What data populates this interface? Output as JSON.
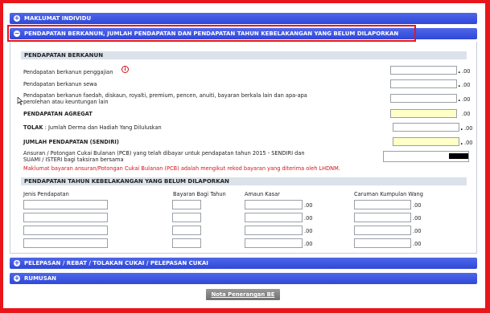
{
  "sections": {
    "maklumat_individu": "MAKLUMAT INDIVIDU",
    "pendapatan": "PENDAPATAN BERKANUN, JUMLAH PENDAPATAN DAN PENDAPATAN TAHUN KEBELAKANGAN YANG BELUM DILAPORKAN",
    "pelepasan": "PELEPASAN / REBAT / TOLAKAN CUKAI / PELEPASAN CUKAI",
    "rumusan": "RUMUSAN"
  },
  "berkanun": {
    "heading": "PENDAPATAN BERKANUN",
    "gaji": "Pendapatan berkanun penggajian",
    "sewa": "Pendapatan berkanun sewa",
    "faedah_1": "Pendapatan berkanun faedah, diskaun, royalti, premium, pencen, anuiti, bayaran berkala lain dan apa-apa",
    "faedah_2": "perolehan atau keuntungan lain",
    "agregat": "PENDAPATAN AGREGAT",
    "tolak_bold": "TOLAK",
    "tolak_rest": ": Jumlah Derma dan Hadiah Yang Diluluskan",
    "sendiri": "JUMLAH PENDAPATAN (SENDIRI)",
    "pcb_1": "Ansuran / Potongan Cukai Bulanan (PCB) yang telah dibayar untuk pendapatan tahun 2015 - SENDIRI dan",
    "pcb_2": "SUAMI / ISTERI bagi taksiran bersama",
    "note": "Maklumat bayaran ansuran/Potongan Cukai Bulanan (PCB) adalah mengikut rekod bayaran yang diterima oleh LHDNM.",
    "suffix": ".00",
    "info": "i"
  },
  "kebelakangan": {
    "heading": "PENDAPATAN TAHUN KEBELAKANGAN YANG BELUM DILAPORKAN",
    "col_jenis": "Jenis Pendapatan",
    "col_bayaran": "Bayaran Bagi Tahun",
    "col_amaun": "Amaun Kasar",
    "col_caruman": "Caruman Kumpulan Wang",
    "suffix": ".00",
    "rows": 4
  },
  "nota_button": "Nota Penerangan BE",
  "colors": {
    "bar": "#2f48d8",
    "highlight": "#e8151b",
    "note_red": "#d4141a",
    "yellow_field": "#ffffc8"
  }
}
